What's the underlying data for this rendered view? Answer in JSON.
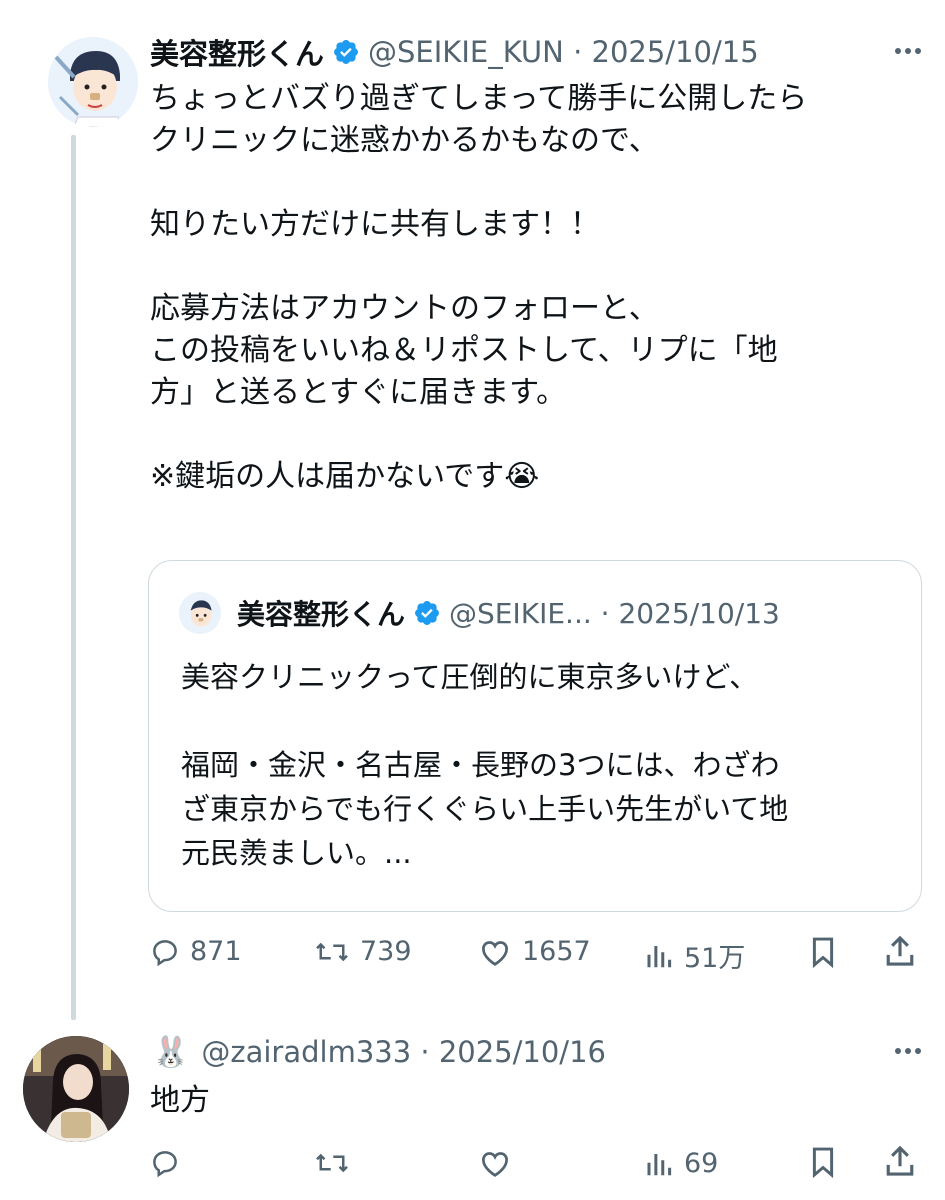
{
  "tweet": {
    "author_name": "美容整形くん",
    "handle_date": "@SEIKIE_KUN · 2025/10/15",
    "body": "ちょっとバズり過ぎてしまって勝手に公開したら\nクリニックに迷惑かかるかもなので、\n\n知りたい方だけに共有します！！\n\n応募方法はアカウントのフォローと、\nこの投稿をいいね＆リポストして、リプに「地\n方」と送るとすぐに届きます。\n\n※鍵垢の人は届かないです😭",
    "quote": {
      "author_name": "美容整形くん",
      "handle_date": "@SEIKIE... · 2025/10/13",
      "body": "美容クリニックって圧倒的に東京多いけど、\n\n福岡・金沢・名古屋・長野の3つには、わざわ\nざ東京からでも行くぐらい上手い先生がいて地\n元民羨ましい。..."
    },
    "stats": {
      "replies": "871",
      "reposts": "739",
      "likes": "1657",
      "views": "51万"
    }
  },
  "reply": {
    "emoji": "🐰",
    "handle_date": "@zairadlm333 · 2025/10/16",
    "body": "地方",
    "stats": {
      "views": "69"
    }
  },
  "colors": {
    "verified": "#1d9bf0",
    "muted": "#536471",
    "border": "#cfd9de"
  },
  "icons": [
    "verified-badge-icon",
    "more-icon",
    "reply-icon",
    "repost-icon",
    "like-icon",
    "views-icon",
    "bookmark-icon",
    "share-icon"
  ]
}
